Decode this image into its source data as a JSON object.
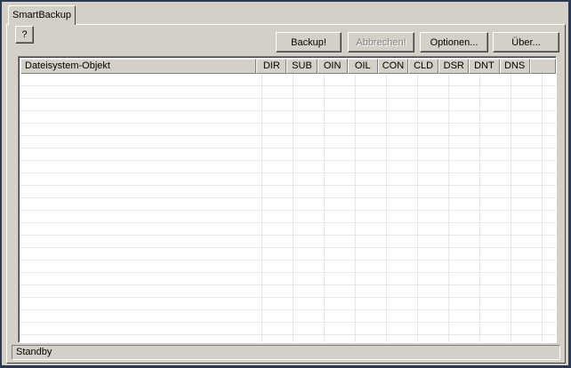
{
  "tab": {
    "label": "SmartBackup"
  },
  "toolbar": {
    "help_label": "?",
    "backup_label": "Backup!",
    "abort_label": "Abbrechen!",
    "options_label": "Optionen...",
    "about_label": "Über..."
  },
  "table": {
    "columns": [
      {
        "label": "Dateisystem-Objekt",
        "width": 272
      },
      {
        "label": "DIR",
        "width": 35
      },
      {
        "label": "SUB",
        "width": 35
      },
      {
        "label": "OIN",
        "width": 35
      },
      {
        "label": "OIL",
        "width": 35
      },
      {
        "label": "CON",
        "width": 35
      },
      {
        "label": "CLD",
        "width": 35
      },
      {
        "label": "DSR",
        "width": 35
      },
      {
        "label": "DNT",
        "width": 35
      },
      {
        "label": "DNS",
        "width": 35
      },
      {
        "label": "",
        "width": 30
      }
    ],
    "rows": []
  },
  "status": {
    "text": "Standby"
  }
}
